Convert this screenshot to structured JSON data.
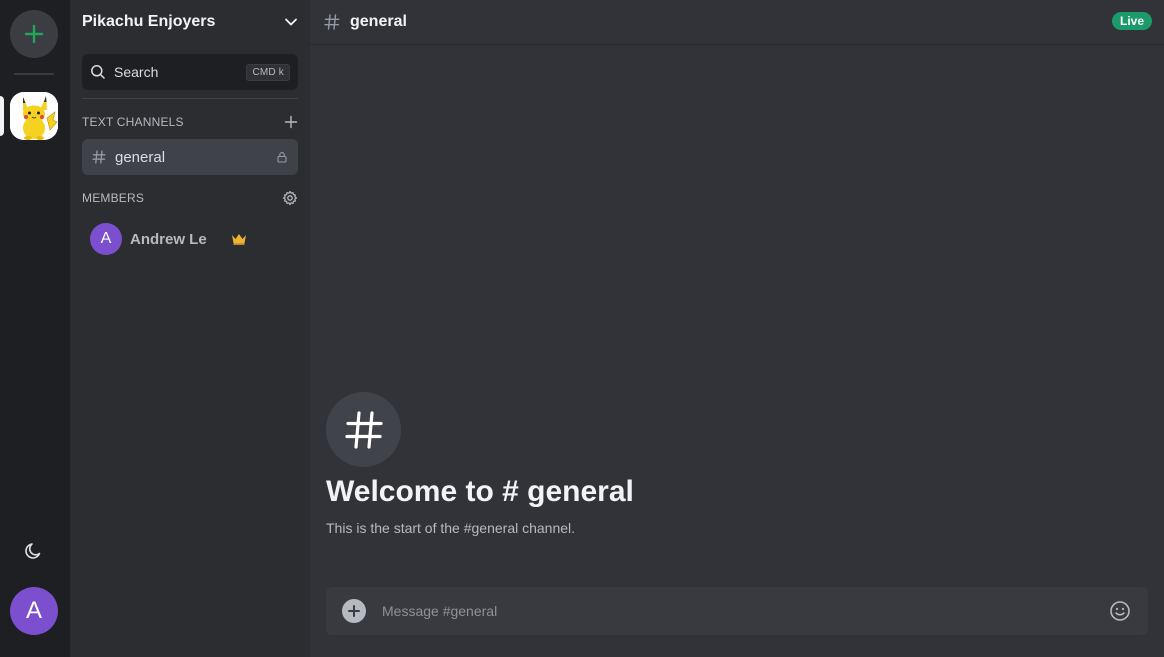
{
  "rail": {
    "add_server_icon": "plus-icon",
    "server_icon": "pikachu-icon",
    "theme_icon": "moon-icon",
    "user_initial": "A"
  },
  "sidebar": {
    "server_name": "Pikachu Enjoyers",
    "search": {
      "label": "Search",
      "shortcut": "CMD k"
    },
    "text_channels": {
      "title": "TEXT CHANNELS",
      "channels": [
        {
          "name": "general",
          "locked": true,
          "active": true
        }
      ]
    },
    "members": {
      "title": "MEMBERS",
      "list": [
        {
          "initial": "A",
          "name": "Andrew Le",
          "badge": "crown-icon"
        }
      ]
    }
  },
  "main": {
    "channel_title": "general",
    "live_label": "Live",
    "welcome_title": "Welcome to # general",
    "welcome_sub": "This is the start of the #general channel.",
    "composer_placeholder": "Message #general"
  },
  "colors": {
    "accent_green": "#1c9a6c",
    "avatar_purple": "#7c4fcf",
    "crown_gold": "#f0b232",
    "rail_bg": "#1e1f22",
    "sidebar_bg": "#2b2d31",
    "main_bg": "#313338"
  }
}
